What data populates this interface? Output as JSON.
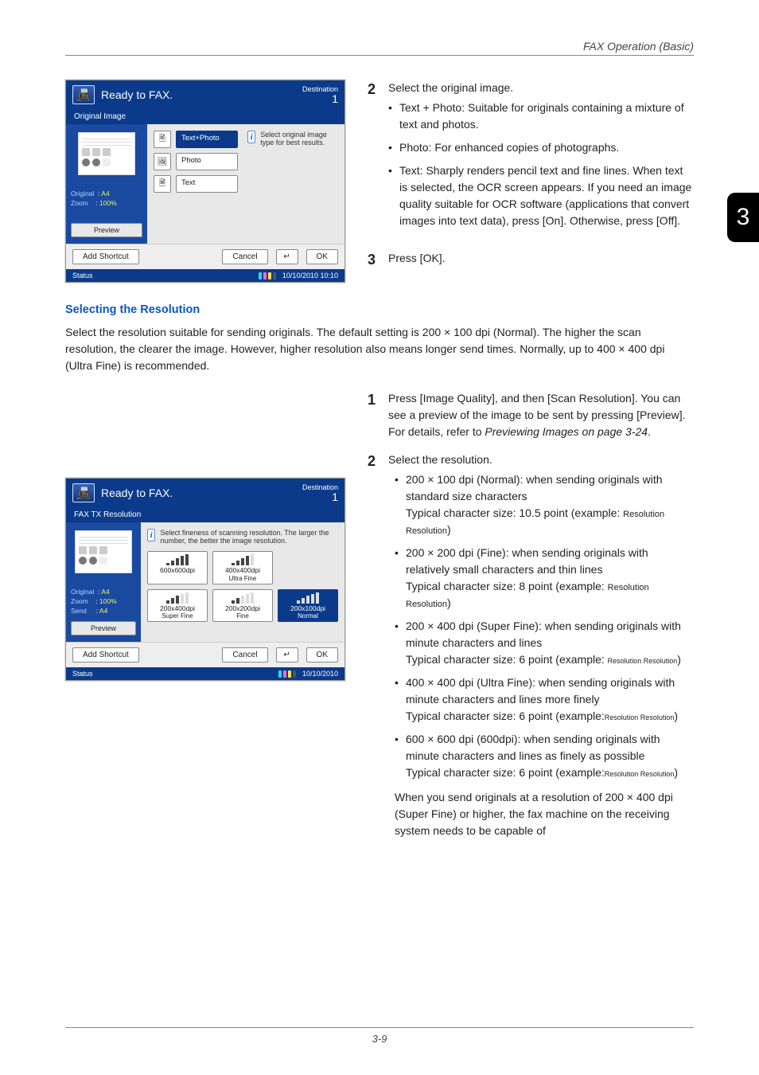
{
  "header": {
    "section": "FAX Operation (Basic)",
    "side_chapter": "3"
  },
  "top_right_steps": {
    "s2_title": "Select the original image.",
    "bullets": [
      "Text + Photo: Suitable for originals containing a mixture of text and photos.",
      "Photo: For enhanced copies of photographs.",
      "Text: Sharply renders pencil text and fine lines. When text is selected, the OCR screen appears. If you need an image quality suitable for OCR software (applications that convert images into text data), press [On]. Otherwise, press [Off]."
    ],
    "s3_title": "Press [OK]."
  },
  "subheading": "Selecting the Resolution",
  "intro_para": "Select the resolution suitable for sending originals. The default setting is 200 × 100 dpi (Normal). The higher the scan resolution, the clearer the image. However, higher resolution also means longer send times. Normally, up to 400 × 400 dpi (Ultra Fine) is recommended.",
  "right_sequence": {
    "s1": "Press [Image Quality], and then [Scan Resolution]. You can see a preview of the image to be sent by pressing [Preview]. For details, refer to ",
    "s1_link": "Previewing Images on page 3-24",
    "s1_tail": ".",
    "s2": "Select the resolution.",
    "res_list": [
      {
        "lead": "200 × 100 dpi (Normal): when sending originals with standard size characters",
        "char": "Typical character size: 10.5 point (example: ",
        "ex": "Resolution Resolution",
        "tail": ")"
      },
      {
        "lead": "200 × 200 dpi (Fine): when sending originals with relatively small characters and thin lines",
        "char": "Typical character size: 8 point (example: ",
        "ex": "Resolution Resolution",
        "tail": ")"
      },
      {
        "lead": "200 × 400 dpi (Super Fine): when sending originals with minute characters and lines",
        "char": "Typical character size: 6 point (example: ",
        "ex": "Resolution Resolution",
        "tail": ")"
      },
      {
        "lead": "400 × 400 dpi (Ultra Fine): when sending originals with minute characters and lines more finely",
        "char": "Typical character size: 6 point (example:",
        "ex": "Resolution Resolution",
        "tail": ")"
      },
      {
        "lead": "600 × 600 dpi (600dpi): when sending originals with minute characters and lines as finely as possible",
        "char": "Typical character size: 6 point (example:",
        "ex": "Resolution Resolution",
        "tail": ")"
      }
    ],
    "note": "When you send originals at a resolution of 200 × 400 dpi (Super Fine) or higher, the fax machine on the receiving system needs to be capable of"
  },
  "panel1": {
    "title": "Ready to FAX.",
    "dest_label": "Destination",
    "dest_count": "1",
    "tab": "Original Image",
    "hint": "Select original image type for best results.",
    "opts": {
      "textphoto": "Text+Photo",
      "photo": "Photo",
      "text": "Text"
    },
    "meta": {
      "orig_l": "Original",
      "orig_v": "A4",
      "zoom_l": "Zoom",
      "zoom_v": "100%",
      "send_l": "",
      "send_v": ""
    },
    "preview": "Preview",
    "add_shortcut": "Add Shortcut",
    "cancel": "Cancel",
    "ok": "OK",
    "status": "Status",
    "datetime": "10/10/2010  10:10"
  },
  "panel2": {
    "title": "Ready to FAX.",
    "dest_label": "Destination",
    "dest_count": "1",
    "tab": "FAX TX Resolution",
    "hint": "Select fineness of scanning resolution. The larger the number, the better the image resolution.",
    "meta": {
      "orig_l": "Original",
      "orig_v": "A4",
      "zoom_l": "Zoom",
      "zoom_v": "100%",
      "send_l": "Send",
      "send_v": "A4"
    },
    "preview": "Preview",
    "options": [
      {
        "line1": "600x600dpi",
        "line2": ""
      },
      {
        "line1": "400x400dpi",
        "line2": "Ultra Fine"
      },
      {
        "line1": "200x400dpi",
        "line2": "Super Fine"
      },
      {
        "line1": "200x200dpi",
        "line2": "Fine"
      },
      {
        "line1": "200x100dpi",
        "line2": "Normal"
      }
    ],
    "add_shortcut": "Add Shortcut",
    "cancel": "Cancel",
    "ok": "OK",
    "status": "Status",
    "datetime": "10/10/2010"
  },
  "footer": {
    "page": "3-9"
  }
}
